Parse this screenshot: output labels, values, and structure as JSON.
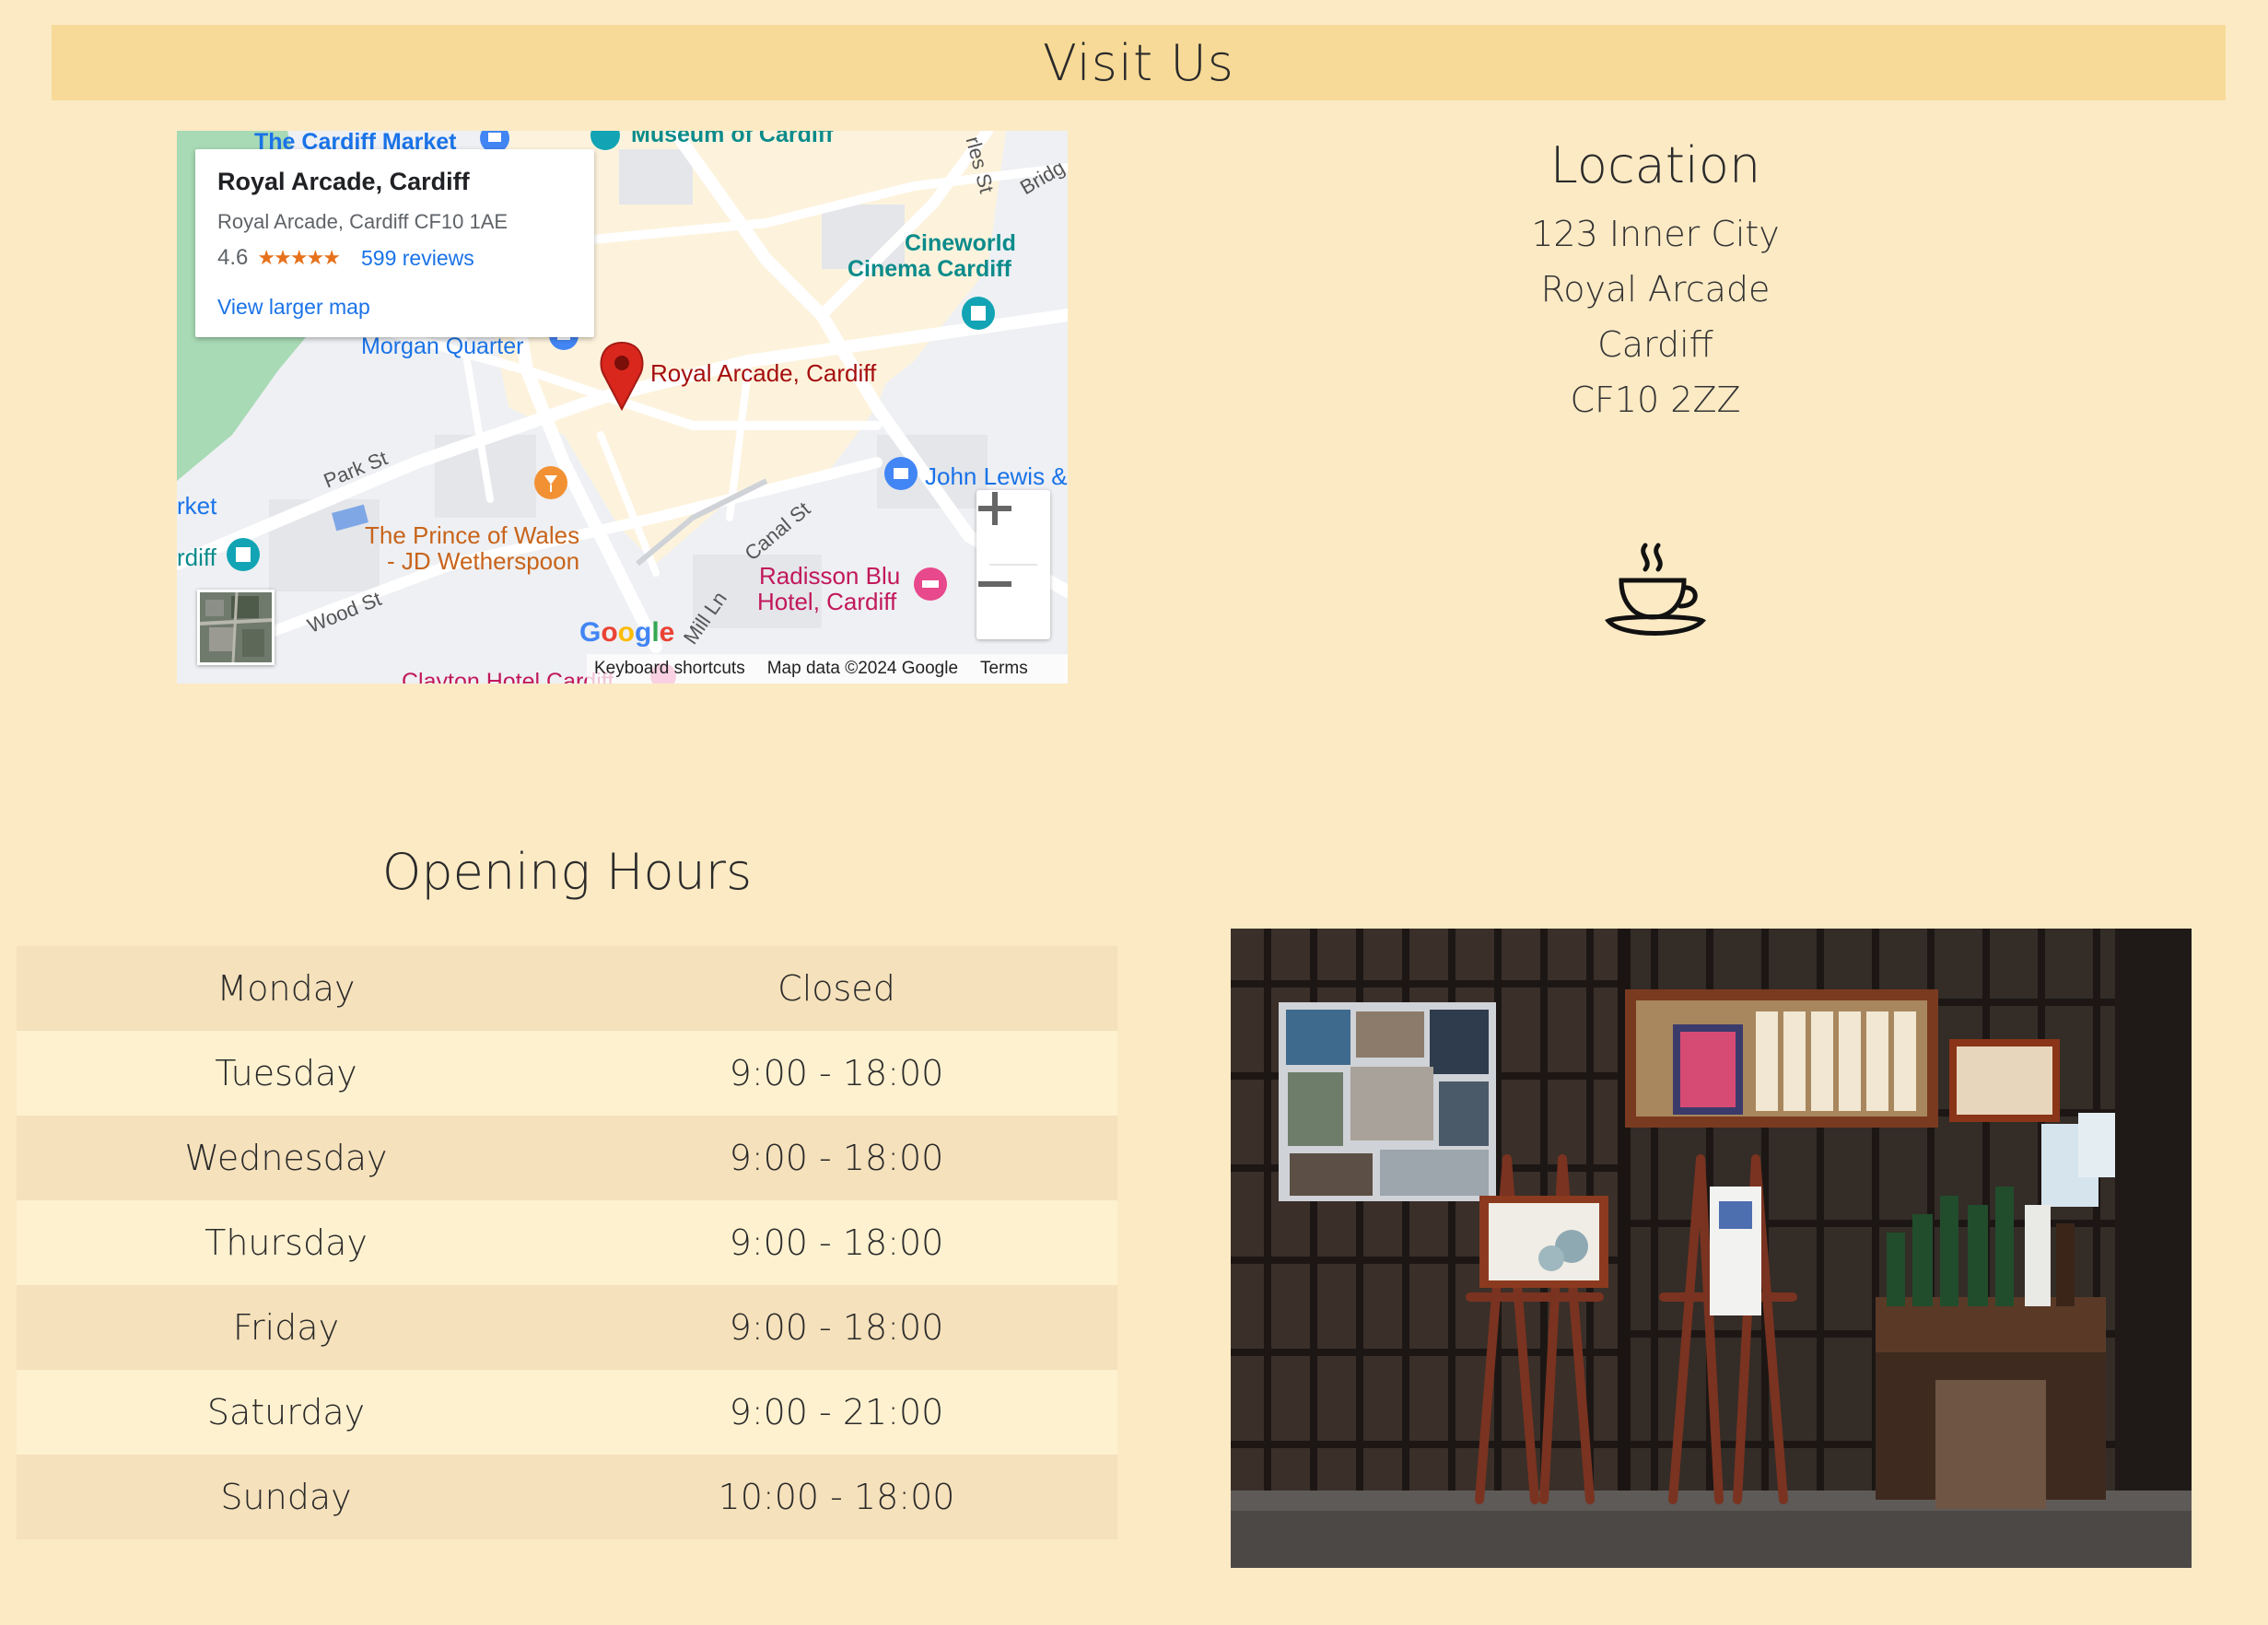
{
  "header": {
    "title": "Visit Us"
  },
  "map": {
    "info": {
      "place_name": "Royal Arcade, Cardiff",
      "address": "Royal Arcade, Cardiff CF10 1AE",
      "rating": "4.6",
      "stars": "★★★★★",
      "reviews": "599 reviews",
      "larger_map": "View larger map"
    },
    "labels": {
      "cardiff_market": "The Cardiff Market",
      "museum": "Museum of Cardiff",
      "cineworld_1": "Cineworld",
      "cineworld_2": "Cinema Cardiff",
      "morgan_quarter": "Morgan Quarter",
      "royal_arcade": "Royal Arcade, Cardiff",
      "park_st": "Park St",
      "market": "rket",
      "diff": "rdiff",
      "prince_1": "The Prince of Wales",
      "prince_2": "- JD Wetherspoon",
      "john_lewis": "John Lewis &",
      "canal_st": "Canal St",
      "radisson_1": "Radisson Blu",
      "radisson_2": "Hotel, Cardiff",
      "wood_st": "Wood St",
      "mill_ln": "Mill Ln",
      "charles_st": "rles St",
      "bridge": "Bridg",
      "clayton": "Clayton Hotel Cardiff",
      "google": "Google"
    },
    "footer": {
      "shortcuts": "Keyboard shortcuts",
      "mapdata": "Map data ©2024 Google",
      "terms": "Terms"
    },
    "zoom_in": "+",
    "zoom_out": "−"
  },
  "location": {
    "title": "Location",
    "lines": [
      "123 Inner City",
      "Royal Arcade",
      "Cardiff",
      "CF10 2ZZ"
    ],
    "icon": "coffee-cup-icon"
  },
  "hours": {
    "title": "Opening Hours",
    "rows": [
      {
        "day": "Monday",
        "time": "Closed"
      },
      {
        "day": "Tuesday",
        "time": "9:00 - 18:00"
      },
      {
        "day": "Wednesday",
        "time": "9:00 - 18:00"
      },
      {
        "day": "Thursday",
        "time": "9:00 - 18:00"
      },
      {
        "day": "Friday",
        "time": "9:00 - 18:00"
      },
      {
        "day": "Saturday",
        "time": "9:00 - 21:00"
      },
      {
        "day": "Sunday",
        "time": "10:00 - 18:00"
      }
    ]
  },
  "colors": {
    "page_bg": "#fbeac4",
    "banner_bg": "#f7da98",
    "row_odd": "#f5e1bb",
    "row_even": "#fef1cf",
    "map_pin": "#d9271e",
    "link_blue": "#1a73e8"
  }
}
